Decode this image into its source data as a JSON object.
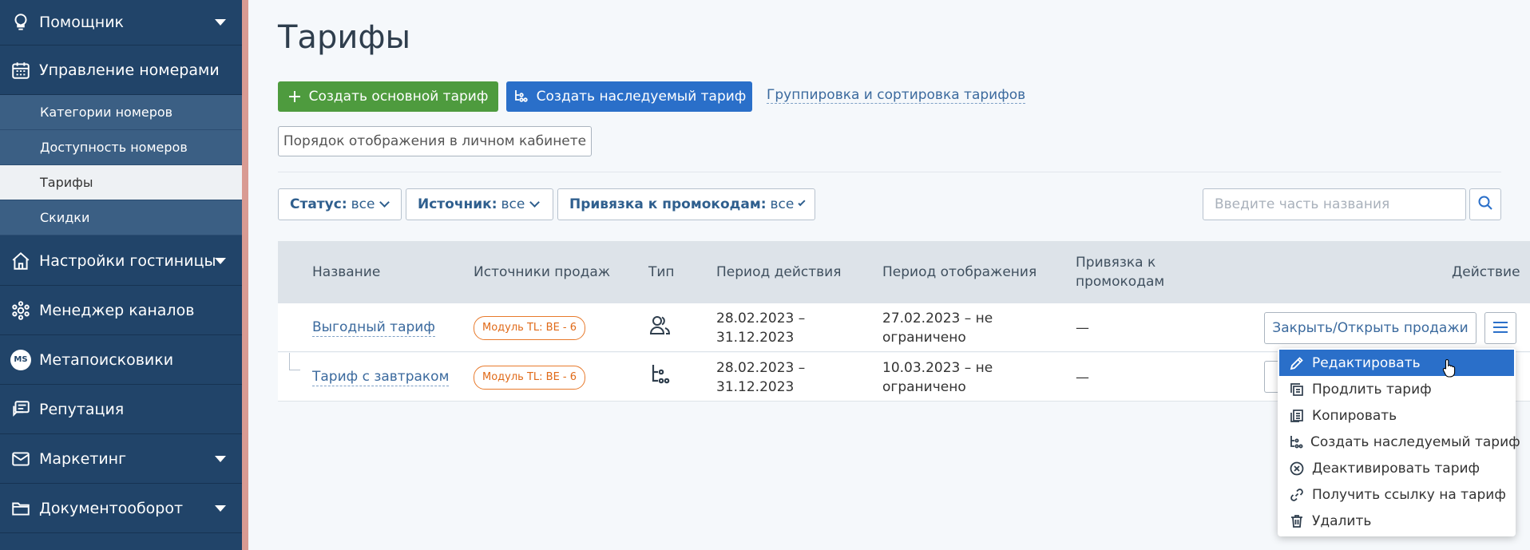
{
  "sidebar": {
    "items": [
      {
        "label": "Помощник",
        "icon": "bulb-icon",
        "has_chevron": true
      },
      {
        "label": "Управление номерами",
        "icon": "calendar-icon",
        "has_chevron": false
      },
      {
        "label": "Настройки гостиницы",
        "icon": "home-icon",
        "has_chevron": true
      },
      {
        "label": "Менеджер каналов",
        "icon": "network-icon",
        "has_chevron": false
      },
      {
        "label": "Метапоисковики",
        "icon": "ms-icon",
        "badge": "MS",
        "has_chevron": false
      },
      {
        "label": "Репутация",
        "icon": "reviews-icon",
        "has_chevron": false
      },
      {
        "label": "Маркетинг",
        "icon": "mail-icon",
        "has_chevron": true
      },
      {
        "label": "Документооборот",
        "icon": "folder-icon",
        "has_chevron": true
      }
    ],
    "sub_items": [
      {
        "label": "Категории номеров",
        "active": false
      },
      {
        "label": "Доступность номеров",
        "active": false
      },
      {
        "label": "Тарифы",
        "active": true
      },
      {
        "label": "Скидки",
        "active": false
      }
    ]
  },
  "page": {
    "title": "Тарифы",
    "create_main_label": "Создать основной тариф",
    "create_inherited_label": "Создать наследуемый тариф",
    "grouping_link": "Группировка и сортировка тарифов",
    "display_order_label": "Порядок отображения в личном кабинете"
  },
  "filters": {
    "status": {
      "label": "Статус:",
      "value": "все"
    },
    "source": {
      "label": "Источник:",
      "value": "все"
    },
    "promo": {
      "label": "Привязка к промокодам:",
      "value": "все"
    },
    "search_placeholder": "Введите часть названия"
  },
  "table": {
    "columns": [
      "Название",
      "Источники продаж",
      "Тип",
      "Период действия",
      "Период отображения",
      "Привязка к промокодам",
      "Действие"
    ],
    "rows": [
      {
        "name": "Выгодный тариф",
        "source": "Модуль TL: BE - 6",
        "type_icon": "users-icon",
        "valid_period": "28.02.2023 – 31.12.2023",
        "display_period": "27.02.2023 – не ограничено",
        "promo": "—",
        "action": "Закрыть/Открыть продажи"
      },
      {
        "name": "Тариф с завтраком",
        "source": "Модуль TL: BE - 6",
        "type_icon": "inherited-icon",
        "valid_period": "28.02.2023 – 31.12.2023",
        "display_period": "10.03.2023 – не ограничено",
        "promo": "—",
        "action": ""
      }
    ]
  },
  "dropdown": {
    "items": [
      {
        "label": "Редактировать",
        "icon": "pencil-icon",
        "active": true
      },
      {
        "label": "Продлить тариф",
        "icon": "extend-icon",
        "active": false
      },
      {
        "label": "Копировать",
        "icon": "copy-icon",
        "active": false
      },
      {
        "label": "Создать наследуемый тариф",
        "icon": "inherited-icon",
        "active": false
      },
      {
        "label": "Деактивировать тариф",
        "icon": "deactivate-icon",
        "active": false
      },
      {
        "label": "Получить ссылку на тариф",
        "icon": "link-icon",
        "active": false
      },
      {
        "label": "Удалить",
        "icon": "trash-icon",
        "active": false
      }
    ]
  },
  "colors": {
    "sidebar_bg": "#214469",
    "sub_item_bg": "#3b5f84",
    "green_button": "#4e9b3e",
    "blue_button": "#2a6fc9",
    "badge_orange": "#e06a18"
  }
}
